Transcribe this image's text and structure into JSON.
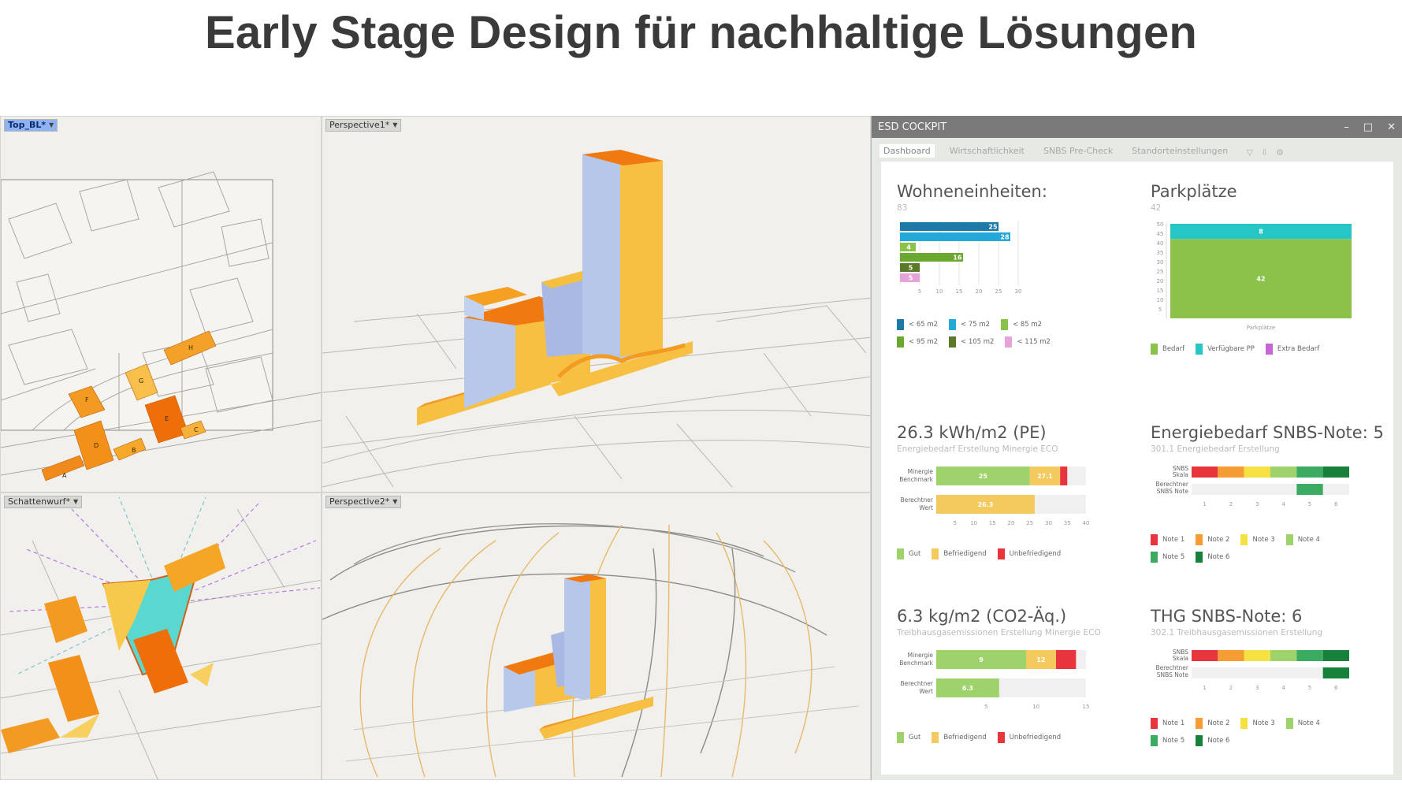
{
  "slide": {
    "title": "Early Stage Design für nachhaltige Lösungen"
  },
  "viewports": {
    "top": {
      "label": "Top_BL*"
    },
    "persp1": {
      "label": "Perspective1*"
    },
    "shadow": {
      "label": "Schattenwurf*"
    },
    "persp2": {
      "label": "Perspective2*"
    },
    "building_labels": [
      "A",
      "B",
      "C",
      "D",
      "E",
      "F",
      "G",
      "H"
    ]
  },
  "cockpit": {
    "title": "ESD COCKPIT",
    "window_buttons": {
      "minimize": "–",
      "maximize": "□",
      "close": "✕"
    },
    "tabs": [
      "Dashboard",
      "Wirtschaftlichkeit",
      "SNBS Pre-Check",
      "Standorteinstellungen"
    ],
    "active_tab": "Dashboard",
    "colors": {
      "dark_blue": "#1d7aa6",
      "cyan": "#22a9d8",
      "lime": "#8bc34a",
      "green": "#6aa832",
      "olive": "#5a7a2a",
      "pink": "#e6a3d8",
      "bedarf": "#8bc34a",
      "verfuegbar": "#26c6c6",
      "extra": "#c765d6",
      "gut": "#9ed26a",
      "befriedigend": "#f4c95d",
      "unbefriedigend": "#e8343c",
      "note1": "#e8343c",
      "note2": "#f59d33",
      "note3": "#f5e142",
      "note4": "#9ed26a",
      "note5": "#3bab62",
      "note6": "#17813b"
    },
    "wohneinheiten": {
      "title": "Wohneneinheiten:",
      "value": "83",
      "chart_data": {
        "type": "bar",
        "orientation": "horizontal",
        "series": [
          {
            "name": "< 65 m2",
            "value": 25
          },
          {
            "name": "< 75 m2",
            "value": 28
          },
          {
            "name": "< 85 m2",
            "value": 4
          },
          {
            "name": "< 95 m2",
            "value": 16
          },
          {
            "name": "< 105 m2",
            "value": 5
          },
          {
            "name": "< 115 m2",
            "value": 5
          }
        ],
        "xticks": [
          "5",
          "10",
          "15",
          "20",
          "25",
          "30"
        ],
        "xlim": [
          0,
          30
        ]
      },
      "legend": [
        "< 65 m2",
        "< 75 m2",
        "< 85 m2",
        "< 95 m2",
        "< 105 m2",
        "< 115 m2"
      ]
    },
    "parkplaetze": {
      "title": "Parkplätze",
      "value": "42",
      "chart_data": {
        "type": "bar",
        "stacked": true,
        "categories": [
          "Parkplätze"
        ],
        "series": [
          {
            "name": "Bedarf",
            "values": [
              42
            ]
          },
          {
            "name": "Verfügbare PP",
            "values": [
              8
            ]
          }
        ],
        "yticks": [
          "50",
          "45",
          "40",
          "35",
          "30",
          "25",
          "20",
          "15",
          "10",
          "5"
        ],
        "ylim": [
          0,
          50
        ]
      },
      "legend": [
        "Bedarf",
        "Verfügbare PP",
        "Extra Bedarf"
      ]
    },
    "energie_pe": {
      "title": "26.3 kWh/m2 (PE)",
      "subtitle": "Energiebedarf Erstellung Minergie ECO",
      "chart_data": {
        "type": "bar",
        "orientation": "horizontal",
        "stacked": true,
        "rows": [
          {
            "label": [
              "Minergie",
              "Benchmark"
            ],
            "segments": [
              {
                "name": "Gut",
                "value": 25
              },
              {
                "name": "Befriedigend",
                "value": 8.1
              },
              {
                "name": "Unbefriedigend",
                "value": 1.9
              }
            ],
            "labels": [
              "25",
              "27.1"
            ]
          },
          {
            "label": [
              "Berechtner",
              "Wert"
            ],
            "segments": [
              {
                "name": "Befriedigend",
                "value": 26.3
              }
            ],
            "labels": [
              "26.3"
            ]
          }
        ],
        "xticks": [
          "5",
          "10",
          "15",
          "20",
          "25",
          "30",
          "35",
          "40"
        ],
        "xlim": [
          0,
          40
        ]
      },
      "legend": [
        "Gut",
        "Befriedigend",
        "Unbefriedigend"
      ]
    },
    "energie_snbs": {
      "title": "Energiebedarf SNBS-Note: 5",
      "subtitle": "301.1 Energiebedarf Erstellung",
      "chart_data": {
        "type": "bar",
        "rows": [
          {
            "label": [
              "SNBS",
              "Skala"
            ],
            "scale": [
              1,
              2,
              3,
              4,
              5,
              6
            ]
          },
          {
            "label": [
              "Berechtner",
              "SNBS Note"
            ],
            "value": 5
          }
        ],
        "xticks": [
          "1",
          "2",
          "3",
          "4",
          "5",
          "6"
        ]
      },
      "legend": [
        "Note 1",
        "Note 2",
        "Note 3",
        "Note 4",
        "Note 5",
        "Note 6"
      ]
    },
    "co2": {
      "title": "6.3 kg/m2 (CO2-Äq.)",
      "subtitle": "Treibhausgasemissionen Erstellung Minergie ECO",
      "chart_data": {
        "type": "bar",
        "orientation": "horizontal",
        "stacked": true,
        "rows": [
          {
            "label": [
              "Minergie",
              "Benchmark"
            ],
            "segments": [
              {
                "name": "Gut",
                "value": 9
              },
              {
                "name": "Befriedigend",
                "value": 3
              },
              {
                "name": "Unbefriedigend",
                "value": 2
              }
            ],
            "labels": [
              "9",
              "12"
            ]
          },
          {
            "label": [
              "Berechtner",
              "Wert"
            ],
            "segments": [
              {
                "name": "Gut",
                "value": 6.3
              }
            ],
            "labels": [
              "6.3"
            ]
          }
        ],
        "xticks": [
          "5",
          "10",
          "15"
        ],
        "xlim": [
          0,
          15
        ]
      },
      "legend": [
        "Gut",
        "Befriedigend",
        "Unbefriedigend"
      ]
    },
    "thg_snbs": {
      "title": "THG SNBS-Note: 6",
      "subtitle": "302.1 Treibhausgasemissionen Erstellung",
      "chart_data": {
        "type": "bar",
        "rows": [
          {
            "label": [
              "SNBS",
              "Skala"
            ],
            "scale": [
              1,
              2,
              3,
              4,
              5,
              6
            ]
          },
          {
            "label": [
              "Berechtner",
              "SNBS Note"
            ],
            "value": 6
          }
        ],
        "xticks": [
          "1",
          "2",
          "3",
          "4",
          "5",
          "6"
        ]
      },
      "legend": [
        "Note 1",
        "Note 2",
        "Note 3",
        "Note 4",
        "Note 5",
        "Note 6"
      ]
    }
  }
}
